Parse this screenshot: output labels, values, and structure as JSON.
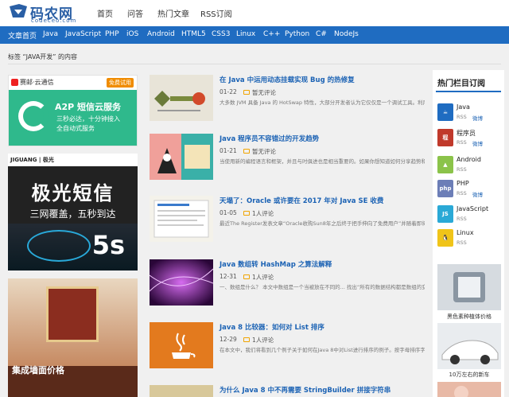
{
  "logo": {
    "text": "码农网",
    "sub": "codeceo.com"
  },
  "topnav": [
    "首页",
    "问答",
    "热门文章",
    "RSS订阅"
  ],
  "navbar": [
    "文章首页",
    "Java",
    "JavaScript",
    "PHP",
    "iOS",
    "Android",
    "HTML5",
    "CSS3",
    "Linux",
    "C++",
    "Python",
    "C#",
    "NodeJs"
  ],
  "breadcrumb": "标签 “JAVA开发” 的内容",
  "ads": {
    "ad1": {
      "brand": "赛邮·云通信",
      "button": "免费试用",
      "title": "A2P 短信云服务",
      "line1": "三秒必达，十分钟接入",
      "line2": "全自动式服务"
    },
    "ad2": {
      "brand": "JIGUANG | 极光",
      "big": "极光短信",
      "sub": "三网覆盖，五秒到达",
      "badge": "5s"
    },
    "ad3": {
      "text": "集成墙面价格"
    }
  },
  "articles": [
    {
      "title": "在 Java 中运用动态挂载实现 Bug 的热修复",
      "date": "01-22",
      "comments": "暂无评论",
      "summary": "大多数 JVM 具备 Java 的 HotSwap 特性，大部分开发者认为它仅仅是一个调试工具。利用这一特性，有可能在不重启 Java 进程条件..."
    },
    {
      "title": "Java 程序员不容错过的开发趋势",
      "date": "01-21",
      "comments": "暂无评论",
      "summary": "当使用新的编程语言和框架，并且与时俱进也是相当重要的。如果你想知道如何分享趋势和精华，那么我们已经准备就绪，只交..."
    },
    {
      "title": "天塌了：Oracle 或许要在 2017 年对 Java SE 收费",
      "date": "01-05",
      "comments": "1人评论",
      "summary": "最近The Register发表文章“Oracle收购Sun8年之后终于把手伸向了免费用户”并随着即将发布“认为Java是“免费”的？再想想2017年吧..."
    },
    {
      "title": "Java 数组转 HashMap 之算法解释",
      "date": "12-31",
      "comments": "1人评论",
      "summary": "一、数组是什么？ 本文中数组是一个当被放在不同的... 找出“所有的数据结构都是数组的变化”，理想将其组织起来..."
    },
    {
      "title": "Java 8 比较器：如何对 List 排序",
      "date": "12-29",
      "comments": "1人评论",
      "summary": "在本文中，我们将看到几个例子关于如何在Java 8中对List进行排序的例子。按字母排序字符串列表 List<String> cities = Arr..."
    },
    {
      "title": "为什么 Java 8 中不再需要 StringBuilder 拼接字符串",
      "date": "",
      "comments": "",
      "summary": ""
    }
  ],
  "sidebar": {
    "title": "热门栏目订阅",
    "rss": "RSS",
    "weibo": "微博",
    "feeds": [
      {
        "name": "Java",
        "color": "#1f6cc1",
        "icon": "java-icon",
        "has_weibo": true
      },
      {
        "name": "程序员",
        "color": "#c0392b",
        "icon": "programmer-icon",
        "has_weibo": true
      },
      {
        "name": "Android",
        "color": "#8bc34a",
        "icon": "android-icon",
        "has_weibo": false
      },
      {
        "name": "PHP",
        "color": "#6c7eb7",
        "icon": "php-icon",
        "has_weibo": true
      },
      {
        "name": "JavaScript",
        "color": "#2aa9d6",
        "icon": "javascript-icon",
        "has_weibo": false
      },
      {
        "name": "Linux",
        "color": "#f0c419",
        "icon": "linux-icon",
        "has_weibo": false
      }
    ],
    "images": [
      {
        "caption": "黑色素种植体价格"
      },
      {
        "caption": "10万左右的新车"
      },
      {
        "caption": ""
      }
    ]
  },
  "colors": {
    "primary": "#1f6cc1",
    "link": "#1b62b4",
    "ad_green": "#2fb98c"
  }
}
